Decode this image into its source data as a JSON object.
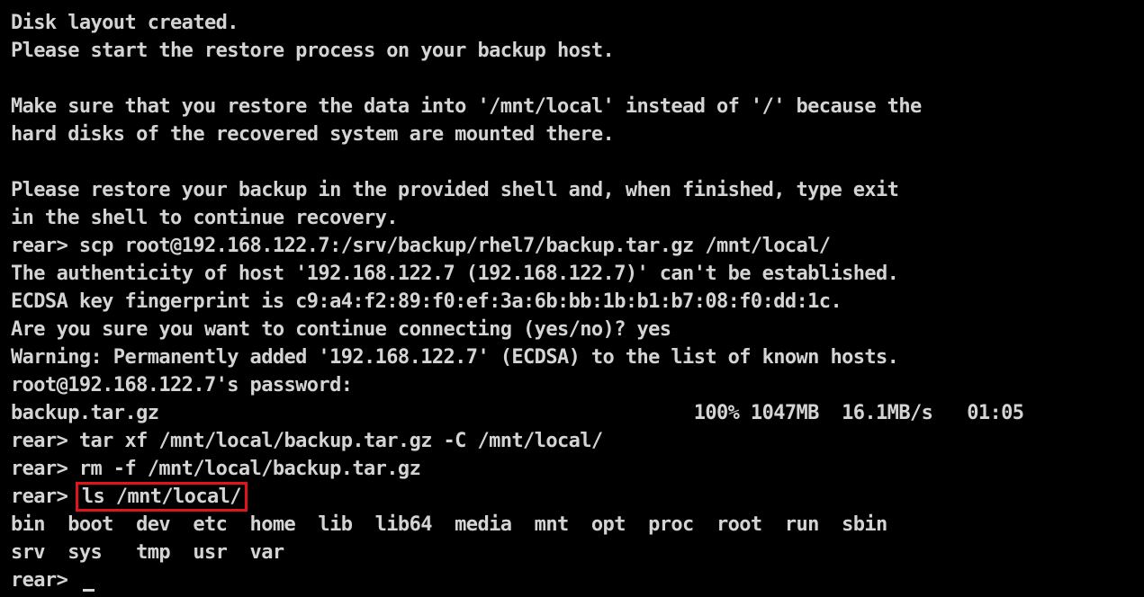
{
  "colors": {
    "background": "#000000",
    "text": "#d4d4d4",
    "highlight_border": "#e0141a"
  },
  "terminal": {
    "lines": [
      "Disk layout created.",
      "Please start the restore process on your backup host.",
      "",
      "Make sure that you restore the data into '/mnt/local' instead of '/' because the",
      "hard disks of the recovered system are mounted there.",
      "",
      "Please restore your backup in the provided shell and, when finished, type exit",
      "in the shell to continue recovery.",
      "rear> scp root@192.168.122.7:/srv/backup/rhel7/backup.tar.gz /mnt/local/",
      "The authenticity of host '192.168.122.7 (192.168.122.7)' can't be established.",
      "ECDSA key fingerprint is c9:a4:f2:89:f0:ef:3a:6b:bb:1b:b1:b7:08:f0:dd:1c.",
      "Are you sure you want to continue connecting (yes/no)? yes",
      "Warning: Permanently added '192.168.122.7' (ECDSA) to the list of known hosts.",
      "root@192.168.122.7's password:",
      "backup.tar.gz                                               100% 1047MB  16.1MB/s   01:05",
      "rear> tar xf /mnt/local/backup.tar.gz -C /mnt/local/",
      "rear> rm -f /mnt/local/backup.tar.gz"
    ],
    "prompt": "rear> ",
    "highlighted_command": "ls /mnt/local/",
    "listing_row1": "bin  boot  dev  etc  home  lib  lib64  media  mnt  opt  proc  root  run  sbin",
    "listing_row2": "srv  sys   tmp  usr  var",
    "final_prompt": "rear> "
  }
}
